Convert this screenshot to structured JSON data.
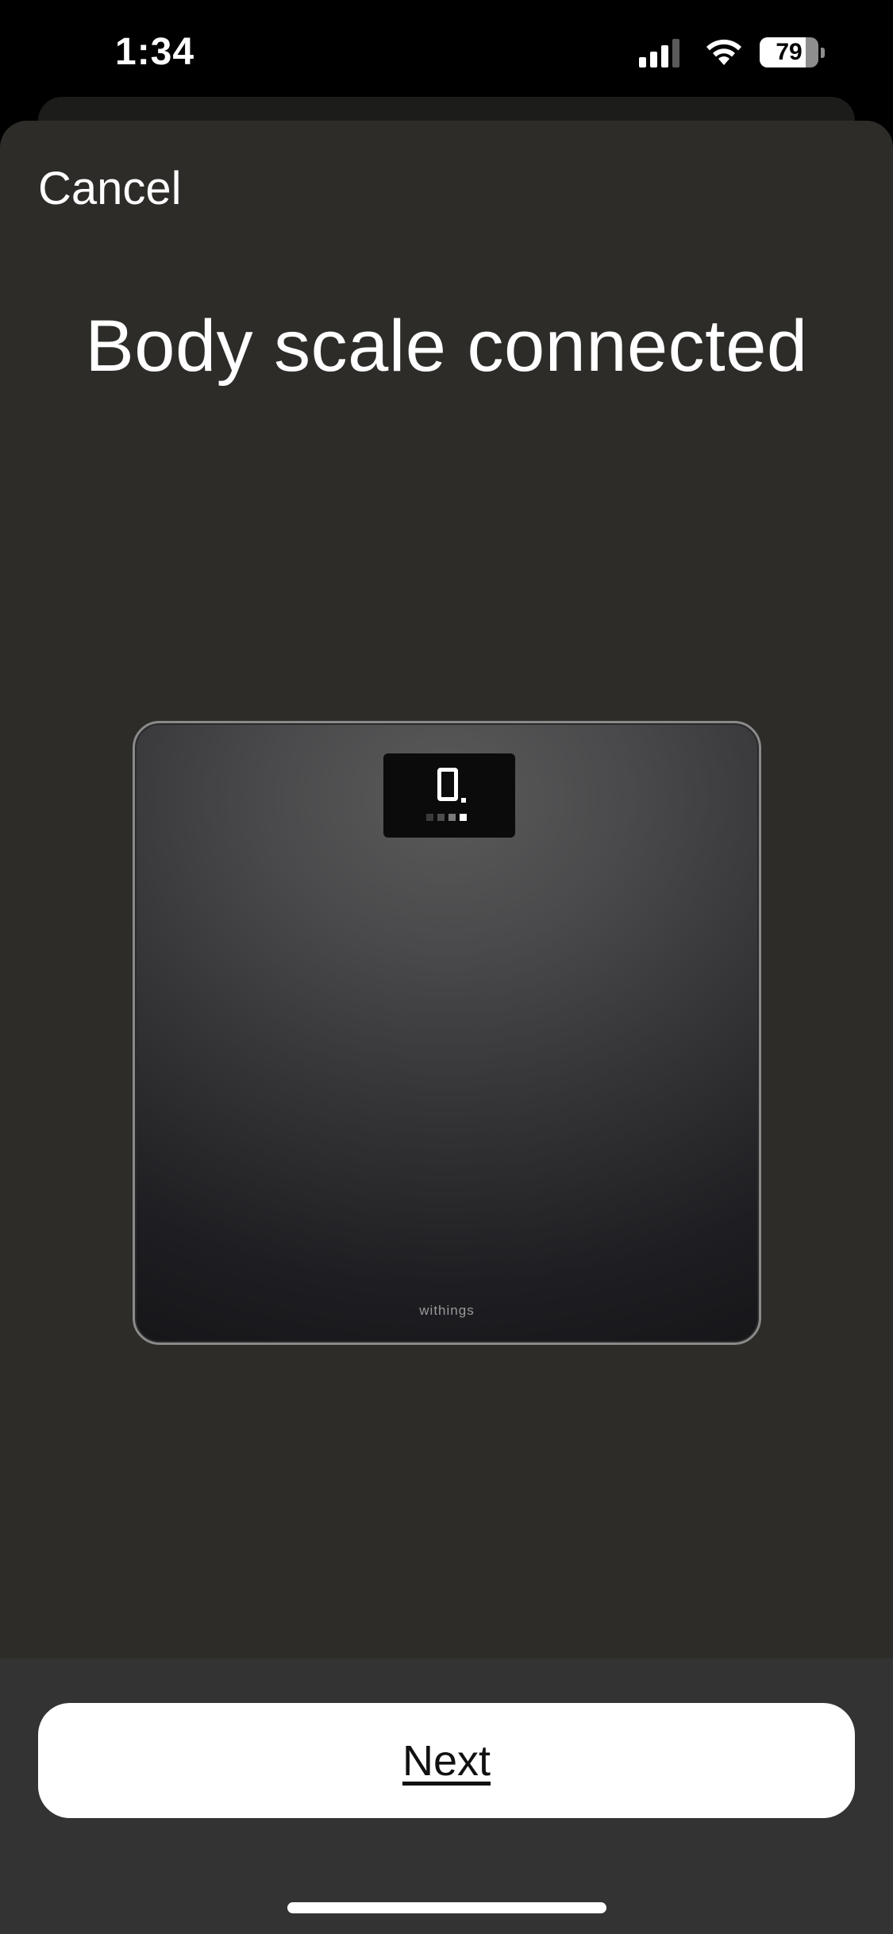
{
  "status_bar": {
    "time": "1:34",
    "battery_level": 79,
    "battery_text": "79",
    "icons": [
      "signal-icon",
      "wifi-icon",
      "battery-icon"
    ]
  },
  "header": {
    "cancel_label": "Cancel",
    "title": "Body scale connected"
  },
  "illustration": {
    "brand_text": "withings",
    "display_digit": "0"
  },
  "footer": {
    "next_label": "Next"
  },
  "colors": {
    "sheet_background": "#2d2c29",
    "bottom_bar": "#333333",
    "primary_button": "#ffffff",
    "text": "#ffffff"
  }
}
